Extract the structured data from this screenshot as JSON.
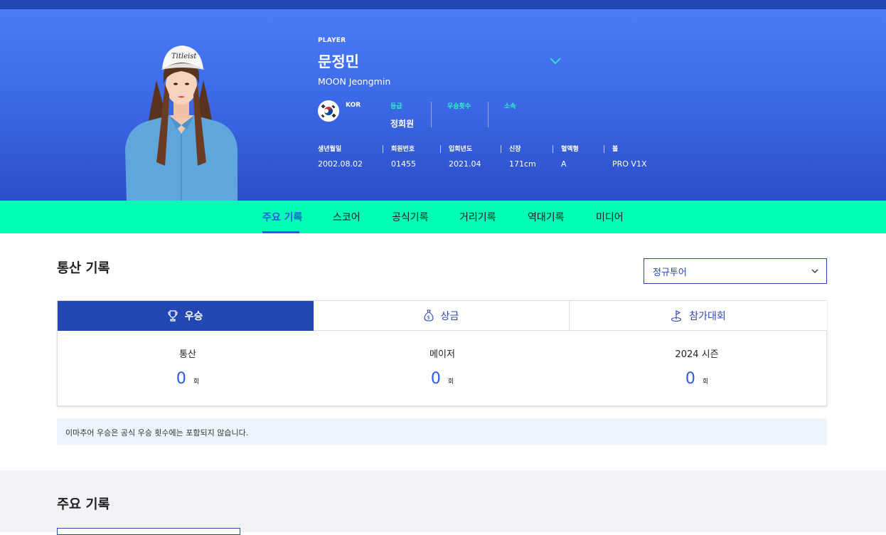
{
  "player": {
    "tag": "PLAYER",
    "name_ko": "문정민",
    "name_en": "MOON Jeongmin",
    "nation": "KOR",
    "grade_label": "등급",
    "grade_value": "정회원",
    "wins_label": "우승횟수",
    "wins_value": "",
    "affiliation_label": "소속",
    "affiliation_value": ""
  },
  "stats": [
    {
      "label": "생년월일",
      "value": "2002.08.02"
    },
    {
      "label": "회원번호",
      "value": "01455"
    },
    {
      "label": "입회년도",
      "value": "2021.04"
    },
    {
      "label": "신장",
      "value": "171cm"
    },
    {
      "label": "혈액형",
      "value": "A"
    },
    {
      "label": "볼",
      "value": "PRO V1X"
    }
  ],
  "tabs": [
    "주요 기록",
    "스코어",
    "공식기록",
    "거리기록",
    "역대기록",
    "미디어"
  ],
  "career": {
    "title": "통산 기록",
    "select_value": "정규투어",
    "card_tabs": [
      "우승",
      "상금",
      "참가대회"
    ],
    "metrics": [
      {
        "label": "통산",
        "value": "0",
        "unit": "회"
      },
      {
        "label": "메이저",
        "value": "0",
        "unit": "회"
      },
      {
        "label": "2024 시즌",
        "value": "0",
        "unit": "회"
      }
    ],
    "notice": "이마추어 우승은 공식 우승 횟수에는 포함되지 않습니다."
  },
  "main_records": {
    "title": "주요 기록"
  },
  "colors": {
    "hero_top": "#4a7cf9",
    "hero_bottom": "#2d4ec9",
    "tab_bar": "#00ffb6",
    "accent": "#2c58e6",
    "navy": "#2347b3",
    "label_mint": "#2ff2c6"
  }
}
